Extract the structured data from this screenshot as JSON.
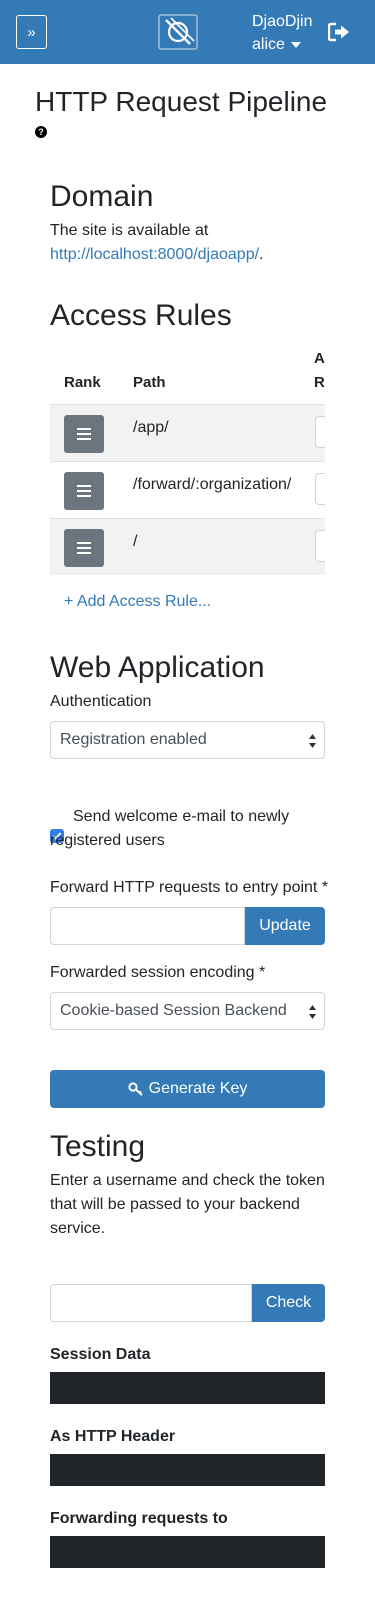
{
  "header": {
    "toggle_icon": "»",
    "brand_icon": "djaodjin-logo-icon",
    "site_name": "DjaoDjin",
    "username": "alice",
    "logout_icon": "sign-out-icon",
    "bar_color": "#337ab7"
  },
  "page": {
    "title": "HTTP Request Pipeline",
    "help_icon": "?"
  },
  "domain": {
    "heading": "Domain",
    "text": "The site is available at",
    "url": "http://localhost:8000/djaoapp/",
    "suffix": "."
  },
  "access_rules": {
    "heading": "Access Rules",
    "columns": [
      "Rank",
      "Path",
      "A",
      "R"
    ],
    "rows": [
      {
        "path": "/app/"
      },
      {
        "path": "/forward/:organization/"
      },
      {
        "path": "/"
      }
    ],
    "add_label": "+ Add Access Rule..."
  },
  "web_app": {
    "heading": "Web Application",
    "auth_label": "Authentication",
    "auth_value": "Registration enabled",
    "welcome_line1": "Send welcome e-mail to newly",
    "welcome_line2": "registered users",
    "welcome_checked": true,
    "entry_label": "Forward HTTP requests to entry point *",
    "entry_value": "",
    "update_label": "Update",
    "encoding_label": "Forwarded session encoding *",
    "encoding_value": "Cookie-based Session Backend",
    "generate_label": "Generate Key"
  },
  "testing": {
    "heading": "Testing",
    "line1": "Enter a username and check the token",
    "line2": "that will be passed to your backend",
    "line3": "service.",
    "username_value": "",
    "check_label": "Check",
    "session_label": "Session Data",
    "header_label": "As HTTP Header",
    "forwarding_label": "Forwarding requests to"
  }
}
